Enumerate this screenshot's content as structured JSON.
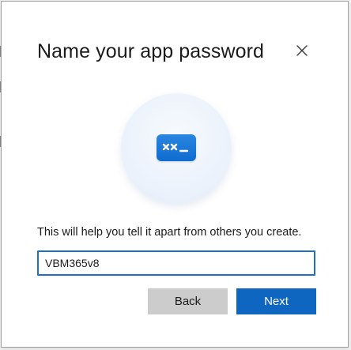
{
  "dialog": {
    "title": "Name your app password",
    "description": "This will help you tell it apart from others you create.",
    "icon": "app-password-icon",
    "name_input": {
      "value": "VBM365v8",
      "placeholder": ""
    },
    "buttons": {
      "back_label": "Back",
      "next_label": "Next"
    },
    "close_icon": "close-icon"
  },
  "colors": {
    "accent": "#0f66c0",
    "input_border": "#1f6fc4",
    "secondary_button": "#cccccc",
    "text": "#1b1b1b"
  }
}
